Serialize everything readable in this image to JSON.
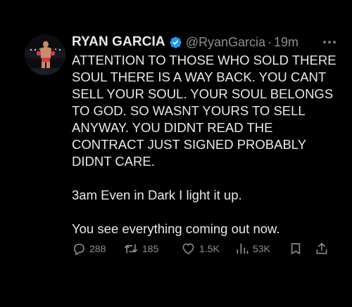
{
  "tweet": {
    "author_name": "RYAN GARCIA",
    "verified_icon": "verified-badge-icon",
    "handle": "@RyanGarcia",
    "separator": "·",
    "time": "19m",
    "more_icon": "more-dots-icon",
    "paragraphs": [
      "ATTENTION TO THOSE WHO SOLD THERE\nSOUL THERE IS A WAY BACK. YOU CANT\nSELL YOUR SOUL. YOUR SOUL BELONGS\nTO GOD. SO WASNT YOURS TO SELL\nANYWAY. YOU DIDNT READ THE\nCONTRACT JUST SIGNED PROBABLY\nDIDNT CARE.",
      "3am Even in Dark I light it up.",
      "You see everything coming out now."
    ]
  },
  "actions": {
    "reply": {
      "icon": "reply-icon",
      "count": "288"
    },
    "retweet": {
      "icon": "retweet-icon",
      "count": "185"
    },
    "like": {
      "icon": "heart-icon",
      "count": "1.5K"
    },
    "views": {
      "icon": "views-chart-icon",
      "count": "53K"
    },
    "bookmark": {
      "icon": "bookmark-icon"
    },
    "share": {
      "icon": "share-icon"
    }
  },
  "colors": {
    "background": "#000000",
    "text": "#e7e9ea",
    "secondary_text": "#8b9096",
    "verified_blue": "#1d9bf0"
  }
}
